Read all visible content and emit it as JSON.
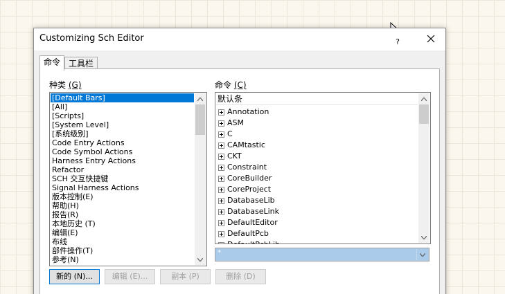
{
  "dialog": {
    "title": "Customizing Sch Editor",
    "help_label": "?",
    "close_icon": "close-icon"
  },
  "tabs": [
    {
      "label": "命令",
      "active": true
    },
    {
      "label": "工具栏",
      "active": false
    }
  ],
  "categories": {
    "label": "种类",
    "accelerator": "(G)",
    "items": [
      {
        "label": "[Default Bars]",
        "selected": true
      },
      {
        "label": "[All]"
      },
      {
        "label": "[Scripts]"
      },
      {
        "label": "[System Level]"
      },
      {
        "label": "[系统级别]"
      },
      {
        "label": "Code Entry Actions"
      },
      {
        "label": "Code Symbol Actions"
      },
      {
        "label": "Harness Entry Actions"
      },
      {
        "label": "Refactor"
      },
      {
        "label": "SCH 交互快捷键"
      },
      {
        "label": "Signal Harness Actions"
      },
      {
        "label": "版本控制(E)"
      },
      {
        "label": "帮助(H)"
      },
      {
        "label": "报告(R)"
      },
      {
        "label": "本地历史 (T)"
      },
      {
        "label": "编辑(E)"
      },
      {
        "label": "布线"
      },
      {
        "label": "部件操作(T)"
      },
      {
        "label": "参考(N)"
      }
    ]
  },
  "commands": {
    "label": "命令",
    "accelerator": "(C)",
    "header": "默认条",
    "items": [
      "Annotation",
      "ASM",
      "C",
      "CAMtastic",
      "CKT",
      "Constraint",
      "CoreBuilder",
      "CoreProject",
      "DatabaseLib",
      "DatabaseLink",
      "DefaultEditor",
      "DefaultPcb",
      "DefaultPcbLib"
    ],
    "combo_value": "*"
  },
  "buttons": {
    "new": "新的 (N)...",
    "edit": "编辑 (E)...",
    "duplicate": "副本 (P)",
    "delete": "删除 (D)"
  },
  "colors": {
    "selection": "#0078d7",
    "combo_background": "#abcbeb",
    "workspace_background": "#fbf7ee"
  }
}
